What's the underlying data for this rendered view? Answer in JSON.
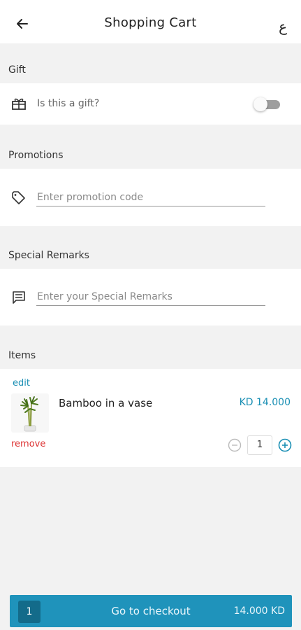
{
  "header": {
    "title": "Shopping Cart",
    "back_icon": "arrow-left-icon",
    "language_toggle": "ع"
  },
  "gift": {
    "section_label": "Gift",
    "question": "Is this a gift?",
    "icon": "gift-icon",
    "toggle_on": false
  },
  "promotions": {
    "section_label": "Promotions",
    "placeholder": "Enter promotion code",
    "value": "",
    "icon": "tag-icon"
  },
  "remarks": {
    "section_label": "Special Remarks",
    "placeholder": "Enter your Special Remarks",
    "value": "",
    "icon": "message-icon"
  },
  "items": {
    "section_label": "Items",
    "list": [
      {
        "edit_label": "edit",
        "name": "Bamboo in a vase",
        "price": "KD 14.000",
        "remove_label": "remove",
        "quantity": "1"
      }
    ]
  },
  "checkout": {
    "count": "1",
    "label": "Go to checkout",
    "total": "14.000 KD"
  },
  "colors": {
    "accent": "#1f93bb",
    "accent_text": "#1a8fb4",
    "danger": "#d33333",
    "badge": "#136b8a"
  }
}
